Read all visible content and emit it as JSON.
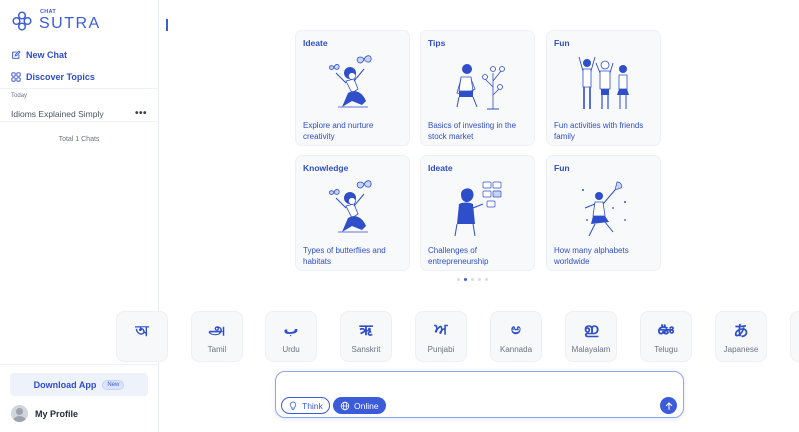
{
  "sidebar": {
    "logo_small": "CHAT",
    "logo_main": "SUTRA",
    "new_chat": "New Chat",
    "discover_topics": "Discover Topics",
    "section_today": "Today",
    "chats": [
      {
        "title": "Idioms Explained Simply",
        "more": "•••"
      }
    ],
    "total_chats": "Total 1 Chats",
    "download_app": "Download App",
    "new_badge": "New",
    "profile": "My Profile"
  },
  "cards": [
    {
      "category": "Ideate",
      "description": "Explore and nurture creativity",
      "illustration": "butterfly-girl-illustration"
    },
    {
      "category": "Tips",
      "description": "Basics of investing in the stock market",
      "illustration": "investor-plant-illustration"
    },
    {
      "category": "Fun",
      "description": "Fun activities with friends family",
      "illustration": "friends-illustration"
    },
    {
      "category": "Knowledge",
      "description": "Types of butterflies and habitats",
      "illustration": "butterfly-girl-illustration"
    },
    {
      "category": "Ideate",
      "description": "Challenges of entrepreneurship",
      "illustration": "entrepreneur-board-illustration"
    },
    {
      "category": "Fun",
      "description": "How many alphabets worldwide",
      "illustration": "alphabet-dancer-illustration"
    }
  ],
  "carousel": {
    "total": 5,
    "active": 1
  },
  "languages": [
    {
      "glyph": "অ",
      "name": ""
    },
    {
      "glyph": "அ",
      "name": "Tamil"
    },
    {
      "glyph": "ب",
      "name": "Urdu"
    },
    {
      "glyph": "ऋ",
      "name": "Sanskrit"
    },
    {
      "glyph": "ਅ",
      "name": "Punjabi"
    },
    {
      "glyph": "ಅ",
      "name": "Kannada"
    },
    {
      "glyph": "ഇ",
      "name": "Malayalam"
    },
    {
      "glyph": "ఊ",
      "name": "Telugu"
    },
    {
      "glyph": "あ",
      "name": "Japanese"
    }
  ],
  "composer": {
    "value": "",
    "think_label": "Think",
    "online_label": "Online"
  },
  "colors": {
    "accent": "#3b5bdb",
    "card_bg": "#f8f9fb"
  }
}
